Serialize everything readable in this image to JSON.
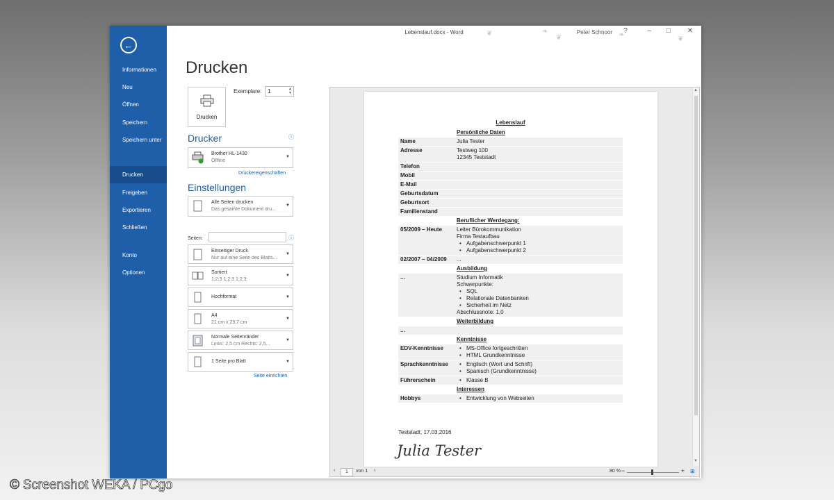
{
  "window": {
    "title": "Lebenslauf.docx - Word",
    "user": "Peter Schnoor",
    "help": "?",
    "minimize": "–",
    "maximize": "□",
    "close": "✕"
  },
  "sidebar": {
    "back": "←",
    "items": [
      {
        "label": "Informationen"
      },
      {
        "label": "Neu"
      },
      {
        "label": "Öffnen"
      },
      {
        "label": "Speichern"
      },
      {
        "label": "Speichern unter"
      },
      {
        "label": "Drucken"
      },
      {
        "label": "Freigeben"
      },
      {
        "label": "Exportieren"
      },
      {
        "label": "Schließen"
      },
      {
        "label": "Konto"
      },
      {
        "label": "Optionen"
      }
    ],
    "active": "Drucken"
  },
  "print": {
    "title": "Drucken",
    "button_label": "Drucken",
    "copies_label": "Exemplare:",
    "copies_value": "1",
    "printer_header": "Drucker",
    "printer_name": "Brother HL-1430",
    "printer_status": "Offline",
    "printer_props_link": "Druckereigenschaften",
    "settings_header": "Einstellungen",
    "settings": [
      {
        "line1": "Alle Seiten drucken",
        "line2": "Das gesamte Dokument dru..."
      },
      {
        "line1": "Einseitiger Druck",
        "line2": "Nur auf eine Seite des Blatts..."
      },
      {
        "line1": "Sortiert",
        "line2": "1;2;3    1;2;3    1;2;3"
      },
      {
        "line1": "Hochformat",
        "line2": ""
      },
      {
        "line1": "A4",
        "line2": "21  cm x 29,7  cm"
      },
      {
        "line1": "Normale Seitenränder",
        "line2": "Links: 2,5  cm    Rechts: 2,5..."
      },
      {
        "line1": "1 Seite pro Blatt",
        "line2": ""
      }
    ],
    "pages_label": "Seiten:",
    "page_setup_link": "Seite einrichten"
  },
  "document": {
    "title": "Lebenslauf",
    "rows": [
      {
        "type": "header",
        "text": "Persönliche Daten"
      },
      {
        "k": "Name",
        "v": "Julia Tester"
      },
      {
        "k": "Adresse",
        "v": "Testweg 100\n12345 Teststadt"
      },
      {
        "k": "Telefon",
        "v": ""
      },
      {
        "k": "Mobil",
        "v": ""
      },
      {
        "k": "E-Mail",
        "v": ""
      },
      {
        "k": "Geburtsdatum",
        "v": ""
      },
      {
        "k": "Geburtsort",
        "v": ""
      },
      {
        "k": "Familienstand",
        "v": ""
      },
      {
        "type": "header",
        "text": "Beruflicher Werdegang:"
      },
      {
        "k": "05/2009 – Heute",
        "v": "Leiter Bürokommunikation\nFirma Testaufbau",
        "bullets": [
          "Aufgabenschwerpunkt 1",
          "Aufgabenschwerpunkt 2"
        ]
      },
      {
        "k": "02/2007 – 04/2009",
        "v": "..."
      },
      {
        "type": "header",
        "text": "Ausbildung"
      },
      {
        "k": "...",
        "v": "Studium Informatik\nSchwerpunkte:",
        "bullets": [
          "SQL",
          "Relationale Datenbanken",
          "Sicherheit im Netz"
        ],
        "after": "Abschlussnote: 1,0"
      },
      {
        "type": "header",
        "text": "Weiterbildung"
      },
      {
        "k": "...",
        "v": ""
      },
      {
        "type": "header",
        "text": "Kenntnisse"
      },
      {
        "k": "EDV-Kenntnisse",
        "v": "",
        "bullets": [
          "MS-Office fortgeschritten",
          "HTML Grundkenntnisse"
        ]
      },
      {
        "k": "Sprachkenntnisse",
        "v": "",
        "bullets": [
          "Englisch (Wort und Schrift)",
          "Spanisch (Grundkenntnisse)"
        ]
      },
      {
        "k": "Führerschein",
        "v": "",
        "bullets": [
          "Klasse B"
        ]
      },
      {
        "type": "header",
        "text": "Interessen"
      },
      {
        "k": "Hobbys",
        "v": "",
        "bullets": [
          "Entwicklung von Webseiten"
        ]
      }
    ],
    "place_date": "Teststadt, 17.03.2016",
    "signature": "Julia Tester"
  },
  "status": {
    "page_input": "1",
    "page_of": "von 1",
    "zoom": "80 %",
    "prev": "‹",
    "next": "›",
    "zoom_minus": "−",
    "zoom_plus": "+"
  },
  "credit": "© Screenshot WEKA / PCgo",
  "colors": {
    "accent": "#1f5ea8"
  }
}
